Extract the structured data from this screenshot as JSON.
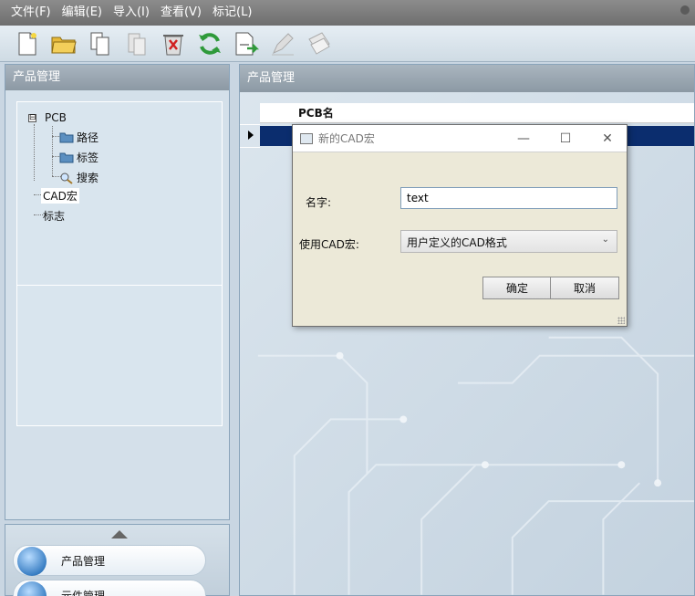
{
  "menu": [
    "文件(F)",
    "编辑(E)",
    "导入(I)",
    "查看(V)",
    "标记(L)"
  ],
  "toolbar": {
    "icons": [
      "new-file-icon",
      "open-folder-icon",
      "copy-icon",
      "paste-icon",
      "delete-icon",
      "refresh-icon",
      "cad-export-icon",
      "edit-icon",
      "stamp-icon"
    ]
  },
  "left_panel": {
    "title": "产品管理",
    "tree": {
      "root": "PCB",
      "root_toggle": "⊟",
      "children": [
        "路径",
        "标签",
        "搜索"
      ],
      "items": [
        "CAD宏",
        "标志"
      ]
    },
    "nav": [
      "产品管理",
      "元件管理"
    ]
  },
  "right_panel": {
    "title": "产品管理",
    "column": "PCB名"
  },
  "dialog": {
    "title": "新的CAD宏",
    "name_label": "名字:",
    "name_value": "text",
    "macro_label": "使用CAD宏:",
    "macro_value": "用户定义的CAD格式",
    "ok": "确定",
    "cancel": "取消",
    "controls": {
      "minimize": "—",
      "maximize": "☐",
      "close": "✕"
    }
  }
}
